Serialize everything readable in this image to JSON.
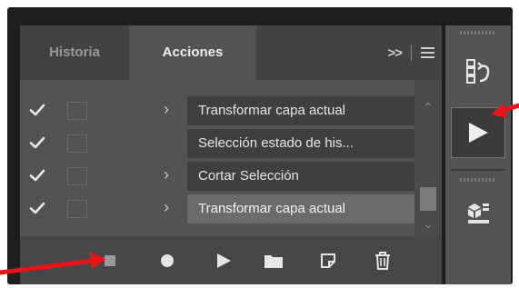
{
  "tabs": [
    {
      "label": "Historia",
      "active": false
    },
    {
      "label": "Acciones",
      "active": true
    }
  ],
  "panel_menu": {
    "expand_icon": "double-chevron-right-icon",
    "menu_icon": "hamburger-menu-icon"
  },
  "rows": [
    {
      "checked": true,
      "has_dialog_toggle": true,
      "expand_icon": "chevron-right-icon",
      "label": "Transformar capa actual",
      "selected": false
    },
    {
      "checked": true,
      "has_dialog_toggle": true,
      "expand_icon": null,
      "label": "Selección estado de his...",
      "selected": false
    },
    {
      "checked": true,
      "has_dialog_toggle": true,
      "expand_icon": "chevron-right-icon",
      "label": "Cortar Selección",
      "selected": false
    },
    {
      "checked": true,
      "has_dialog_toggle": true,
      "expand_icon": "chevron-right-icon",
      "label": "Transformar capa actual",
      "selected": true
    }
  ],
  "toolbar": [
    {
      "name": "stop-icon",
      "annotated": true
    },
    {
      "name": "record-icon"
    },
    {
      "name": "play-icon"
    },
    {
      "name": "new-set-folder-icon"
    },
    {
      "name": "new-action-icon"
    },
    {
      "name": "trash-icon"
    }
  ],
  "dock": [
    {
      "name": "history-panel-icon"
    },
    {
      "name": "actions-panel-play-icon",
      "active": true,
      "annotated": true
    },
    {
      "name": "adjustments-panel-icon"
    }
  ],
  "colors": {
    "panel_bg": "#535353",
    "tabbar_bg": "#424242",
    "row_label_bg": "#3f3f3f",
    "row_selected_bg": "#6b6b6b",
    "annotation_arrow": "#e8141a"
  }
}
